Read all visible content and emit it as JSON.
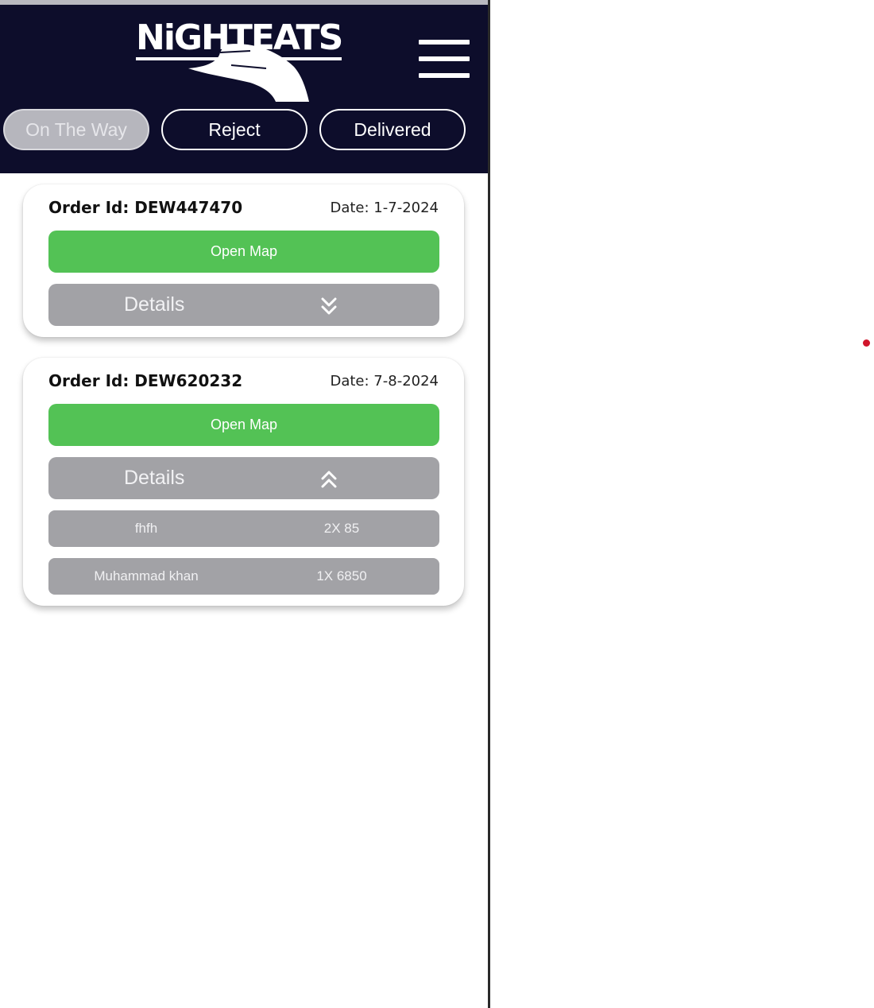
{
  "app": {
    "logo_text": "NiGHTEATS"
  },
  "tabs": [
    {
      "label": "On The Way",
      "active": true
    },
    {
      "label": "Reject",
      "active": false
    },
    {
      "label": "Delivered",
      "active": false
    }
  ],
  "orders": [
    {
      "order_id": "Order Id: DEW447470",
      "date": "Date: 1-7-2024",
      "map_label": "Open Map",
      "details_label": "Details",
      "expanded": false,
      "items": []
    },
    {
      "order_id": "Order Id: DEW620232",
      "date": "Date: 7-8-2024",
      "map_label": "Open Map",
      "details_label": "Details",
      "expanded": true,
      "items": [
        {
          "name": "fhfh",
          "qty": "2X 85"
        },
        {
          "name": "Muhammad khan",
          "qty": "1X 6850"
        }
      ]
    }
  ],
  "colors": {
    "header_bg": "#0d0d2b",
    "map_button": "#53c255",
    "details_button": "#a2a2a6",
    "active_tab": "#b6b6bd",
    "marker": "#d0152b"
  },
  "icons": {
    "menu": "hamburger-menu-icon",
    "collapsed": "chevron-double-down-icon",
    "expanded": "chevron-double-up-icon",
    "logo": "hand-logo-icon"
  }
}
